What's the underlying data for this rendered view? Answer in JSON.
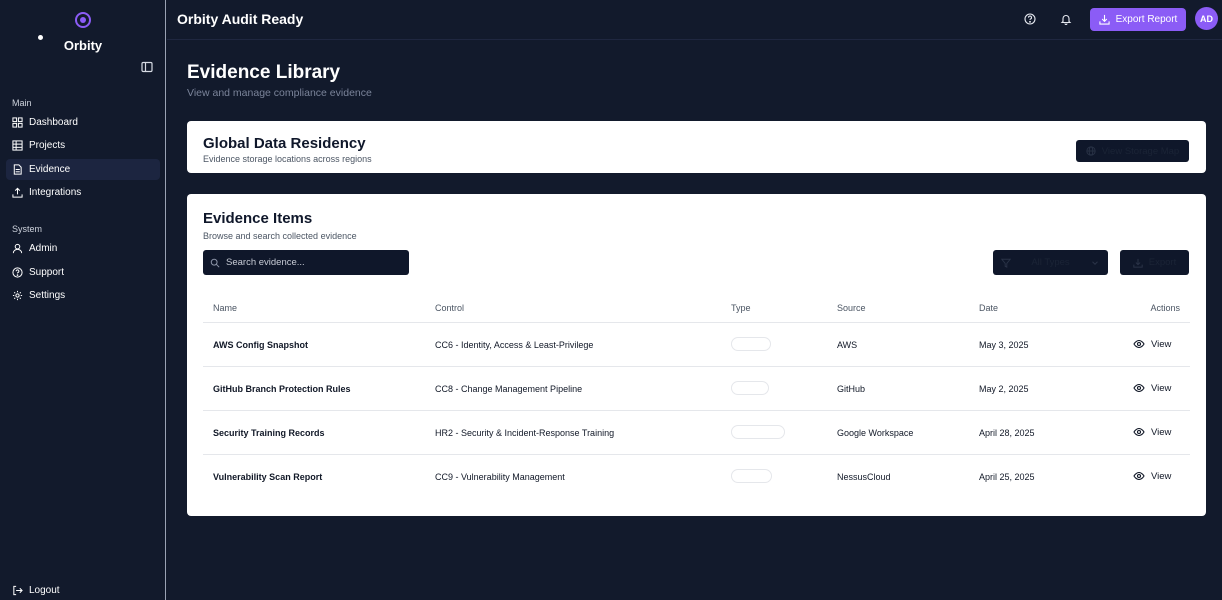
{
  "sidebar": {
    "brand": "Orbity",
    "sections": {
      "main": "Main",
      "system": "System"
    },
    "main_items": [
      {
        "label": "Dashboard",
        "icon": "grid-icon"
      },
      {
        "label": "Projects",
        "icon": "table-icon"
      },
      {
        "label": "Evidence",
        "icon": "document-icon",
        "active": true
      },
      {
        "label": "Integrations",
        "icon": "upload-icon"
      }
    ],
    "system_items": [
      {
        "label": "Admin",
        "icon": "user-icon"
      },
      {
        "label": "Support",
        "icon": "help-circle-icon"
      },
      {
        "label": "Settings",
        "icon": "gear-icon"
      }
    ],
    "logout": "Logout"
  },
  "header": {
    "title": "Orbity Audit Ready",
    "export_report": "Export Report",
    "avatar_initials": "AD"
  },
  "page": {
    "title": "Evidence Library",
    "subtitle": "View and manage compliance evidence"
  },
  "residency": {
    "title": "Global Data Residency",
    "subtitle": "Evidence storage locations across regions",
    "button": "View Storage Map"
  },
  "evidence": {
    "title": "Evidence Items",
    "subtitle": "Browse and search collected evidence",
    "search_placeholder": "Search evidence...",
    "filter_value": "All Types",
    "export_label": "Export",
    "columns": {
      "name": "Name",
      "control": "Control",
      "type": "Type",
      "source": "Source",
      "date": "Date",
      "actions": "Actions"
    },
    "rows": [
      {
        "name": "AWS Config Snapshot",
        "control": "CC6 - Identity, Access & Least-Privilege",
        "source": "AWS",
        "date": "May 3, 2025",
        "action": "View"
      },
      {
        "name": "GitHub Branch Protection Rules",
        "control": "CC8 - Change Management Pipeline",
        "source": "GitHub",
        "date": "May 2, 2025",
        "action": "View"
      },
      {
        "name": "Security Training Records",
        "control": "HR2 - Security & Incident-Response Training",
        "source": "Google Workspace",
        "date": "April 28, 2025",
        "action": "View"
      },
      {
        "name": "Vulnerability Scan Report",
        "control": "CC9 - Vulnerability Management",
        "source": "NessusCloud",
        "date": "April 25, 2025",
        "action": "View"
      }
    ]
  },
  "colors": {
    "background": "#121a2c",
    "accent": "#8b5cf6",
    "card": "#ffffff",
    "dark_control": "#0f172a"
  }
}
